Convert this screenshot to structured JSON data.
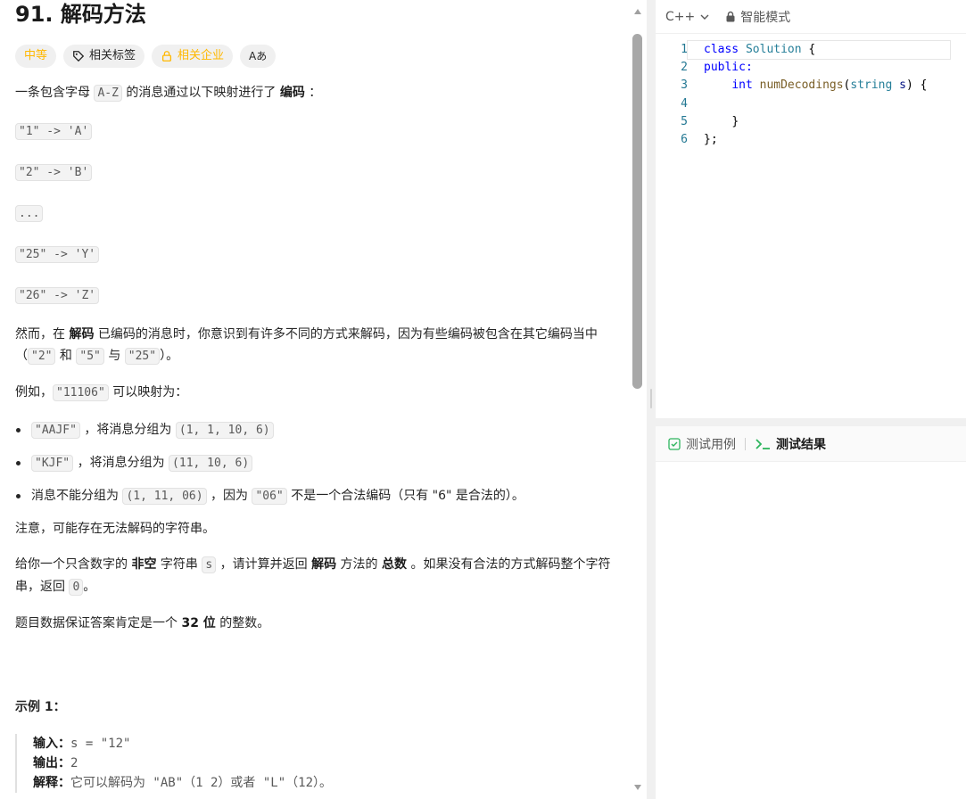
{
  "problem": {
    "title": "91. 解码方法",
    "tags": {
      "difficulty": "中等",
      "related_tags": "相关标签",
      "related_companies": "相关企业",
      "font_toggle": "Aあ"
    },
    "intro_before": "一条包含字母 ",
    "intro_code": "A-Z",
    "intro_after": " 的消息通过以下映射进行了 ",
    "intro_bold": "编码",
    "intro_end": " ：",
    "mappings": [
      "\"1\" -> 'A'",
      "\"2\" -> 'B'",
      "...",
      "\"25\" -> 'Y'",
      "\"26\" -> 'Z'"
    ],
    "para2_a": "然而，在 ",
    "para2_b": "解码",
    "para2_c": " 已编码的消息时，你意识到有许多不同的方式来解码，因为有些编码被包含在其它编码当中（",
    "para2_code1": "\"2\"",
    "para2_d": " 和 ",
    "para2_code2": "\"5\"",
    "para2_e": " 与 ",
    "para2_code3": "\"25\"",
    "para2_f": "）。",
    "example_intro_a": "例如，",
    "example_intro_code": "\"11106\"",
    "example_intro_b": " 可以映射为：",
    "bullets": [
      {
        "code1": "\"AAJF\"",
        "text": " ，将消息分组为 ",
        "code2": "(1, 1, 10, 6)",
        "tail": ""
      },
      {
        "code1": "\"KJF\"",
        "text": " ，将消息分组为 ",
        "code2": "(11, 10, 6)",
        "tail": ""
      }
    ],
    "bullet3_a": "消息不能分组为 ",
    "bullet3_code1": "(1, 11, 06)",
    "bullet3_b": " ，因为 ",
    "bullet3_code2": "\"06\"",
    "bullet3_c": " 不是一个合法编码（只有 \"6\" 是合法的）。",
    "note": "注意，可能存在无法解码的字符串。",
    "task_a": "给你一个只含数字的 ",
    "task_b": "非空",
    "task_c": " 字符串 ",
    "task_code": "s",
    "task_d": " ，请计算并返回 ",
    "task_e": "解码",
    "task_f": " 方法的 ",
    "task_g": "总数",
    "task_h": " 。如果没有合法的方式解码整个字符串，返回 ",
    "task_code2": "0",
    "task_i": "。",
    "guarantee_a": "题目数据保证答案肯定是一个 ",
    "guarantee_b": "32 位",
    "guarantee_c": " 的整数。",
    "example1_title": "示例 1：",
    "example1_input_label": "输入：",
    "example1_input": "s = \"12\"",
    "example1_output_label": "输出：",
    "example1_output": "2",
    "example1_explain_label": "解释：",
    "example1_explain": "它可以解码为 \"AB\"（1 2）或者 \"L\"（12）。"
  },
  "editor": {
    "language": "C++",
    "mode": "智能模式",
    "lines": [
      {
        "num": "1"
      },
      {
        "num": "2"
      },
      {
        "num": "3"
      },
      {
        "num": "4"
      },
      {
        "num": "5"
      },
      {
        "num": "6"
      }
    ],
    "code": {
      "kw_class": "class",
      "class_name": "Solution",
      "brace_open": " {",
      "kw_public": "public:",
      "kw_int": "int",
      "fn_name": "numDecodings",
      "paren_open": "(",
      "type_string": "string",
      "param": "s",
      "paren_close": ") {",
      "close_fn": "}",
      "close_class": "};"
    }
  },
  "test_panel": {
    "tab_cases": "测试用例",
    "tab_results": "测试结果"
  }
}
